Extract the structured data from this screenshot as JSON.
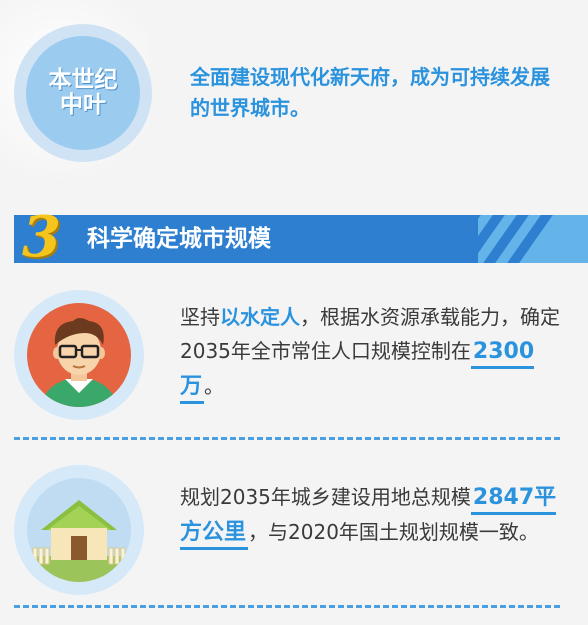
{
  "top": {
    "era_label": "本世纪中叶",
    "text": "全面建设现代化新天府，成为可持续发展的世界城市。"
  },
  "section": {
    "number": "3",
    "title": "科学确定城市规模"
  },
  "items": [
    {
      "icon": "person-icon",
      "text_parts": [
        "坚持",
        "以水定人",
        "，根据水资源承载能力，确定2035年全市常住人口规模控制在",
        "2300万",
        "。"
      ]
    },
    {
      "icon": "house-icon",
      "text_parts": [
        "规划2035年城乡建设用地总规模",
        "2847平方公里",
        "，与2020年国土规划规模一致。"
      ]
    }
  ],
  "colors": {
    "accent": "#2b93de",
    "banner": "#2e7fcf",
    "number": "#f5c51b",
    "person_bg": "#e56441"
  }
}
